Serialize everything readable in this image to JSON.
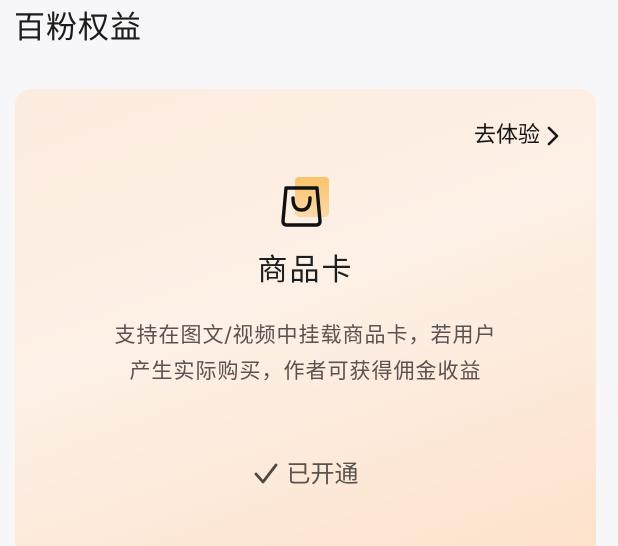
{
  "section": {
    "title": "百粉权益"
  },
  "card": {
    "try_link_label": "去体验",
    "title": "商品卡",
    "description_lines": [
      "支持在图文/视频中挂载商品卡，若用户",
      "产生实际购买，作者可获得佣金收益"
    ],
    "status_label": "已开通",
    "icons": {
      "product": "shopping-bag-icon",
      "link": "chevron-right-icon",
      "status": "check-icon"
    },
    "colors": {
      "gradient_start": "#fdece0",
      "gradient_end": "#fde2cb",
      "bag_accent": "#f9c46a"
    }
  }
}
